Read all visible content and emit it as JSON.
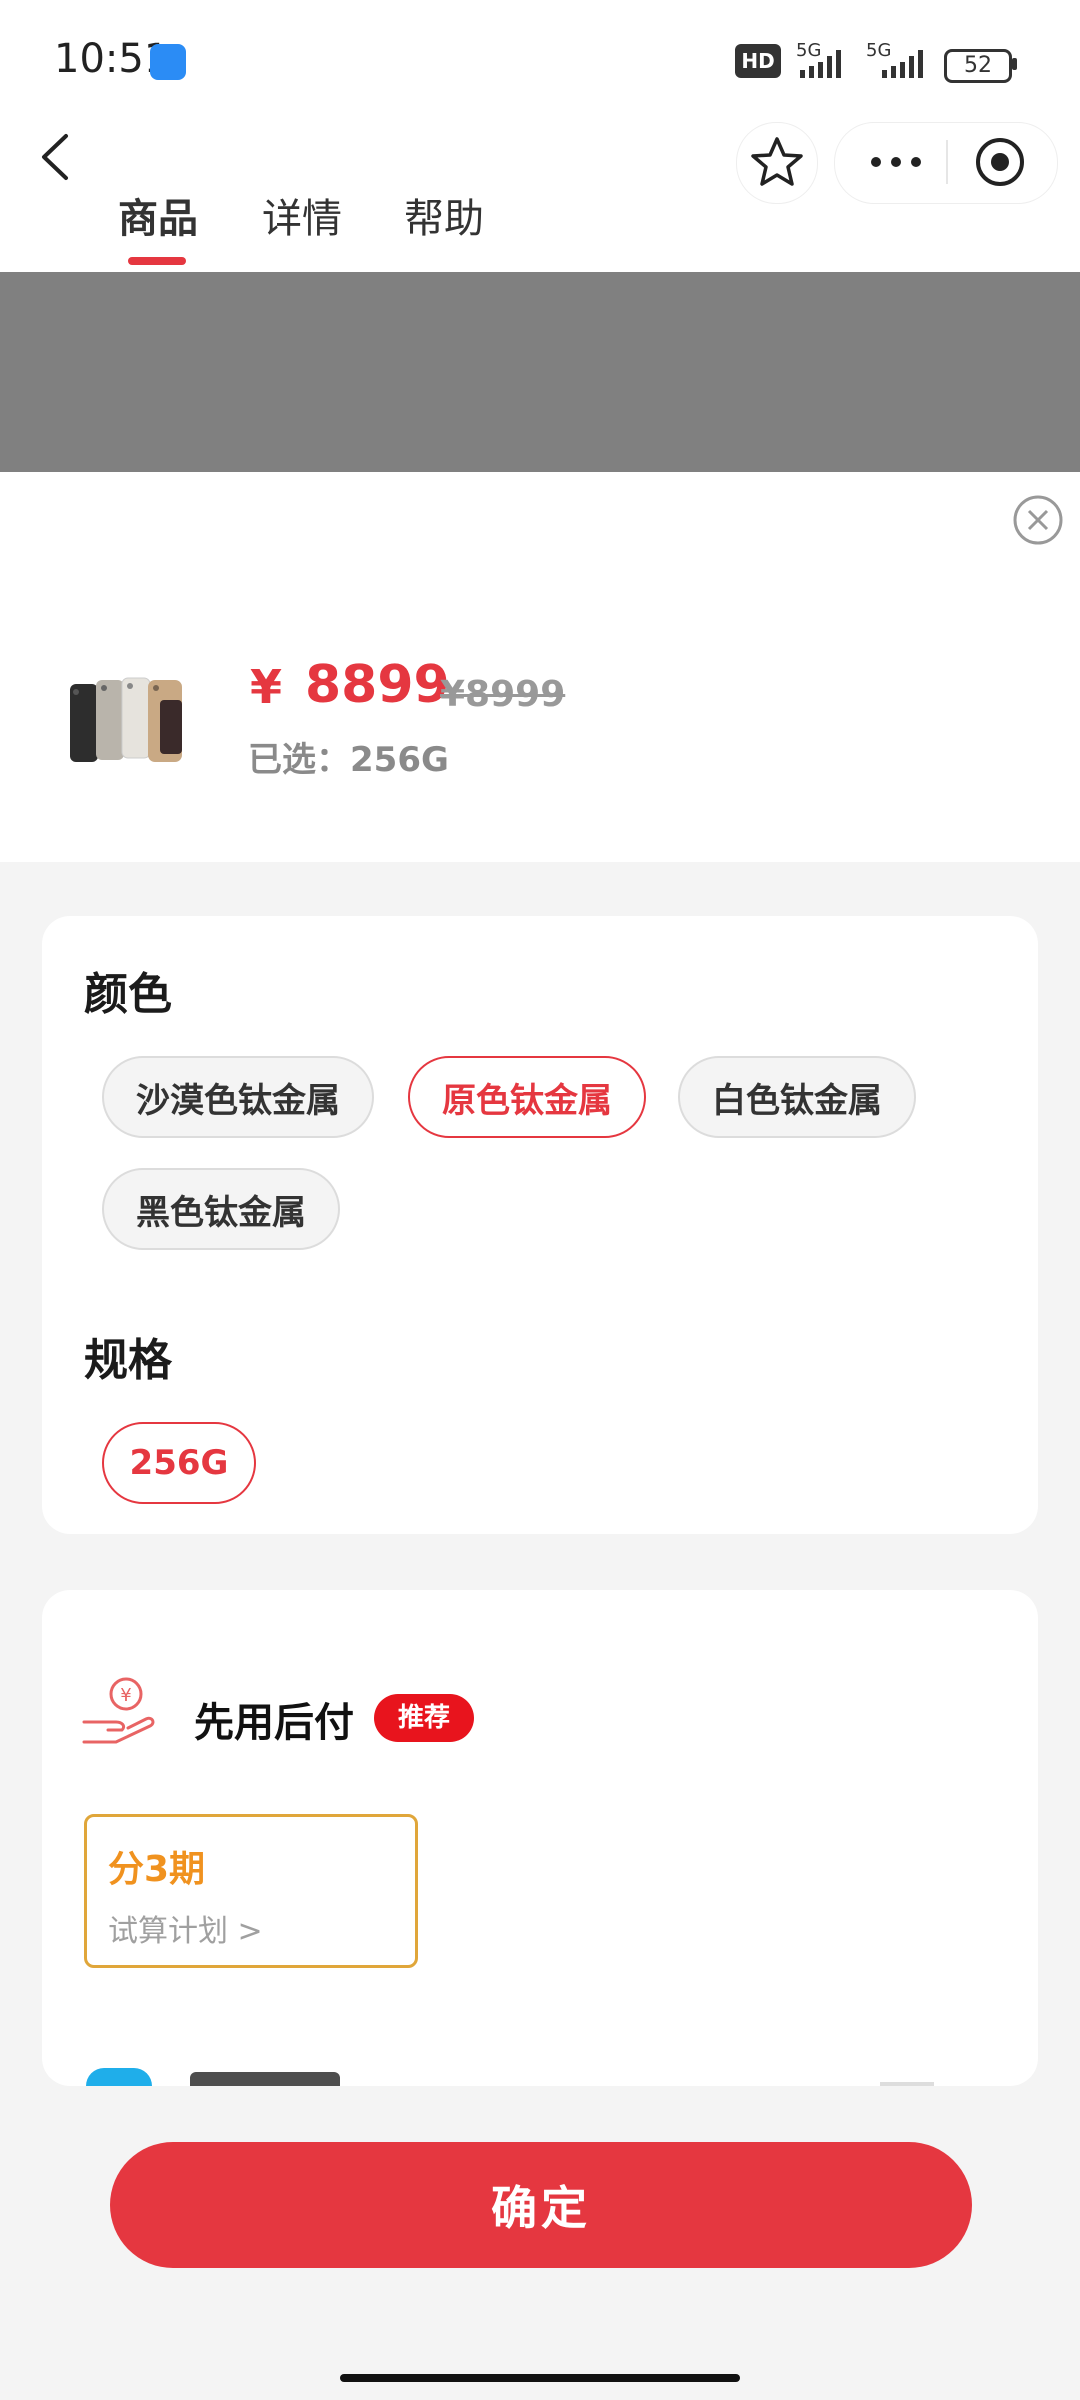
{
  "status_bar": {
    "time": "10:51",
    "hd_label": "HD",
    "net1": "5G",
    "net2": "5G",
    "battery": "52"
  },
  "nav": {
    "tabs": [
      {
        "label": "商品",
        "active": true
      },
      {
        "label": "详情",
        "active": false
      },
      {
        "label": "帮助",
        "active": false
      }
    ],
    "icons": [
      "back-icon",
      "star-icon",
      "more-icon",
      "target-icon"
    ]
  },
  "product": {
    "currency": "¥",
    "price": "8899",
    "original_price": "¥8999",
    "selected_label": "已选：256G"
  },
  "colors_section": {
    "title": "颜色",
    "options": [
      {
        "label": "沙漠色钛金属",
        "selected": false
      },
      {
        "label": "原色钛金属",
        "selected": true
      },
      {
        "label": "白色钛金属",
        "selected": false
      },
      {
        "label": "黑色钛金属",
        "selected": false
      }
    ]
  },
  "spec_section": {
    "title": "规格",
    "options": [
      {
        "label": "256G",
        "selected": true
      }
    ]
  },
  "payment": {
    "title": "先用后付",
    "badge": "推荐",
    "plan_title": "分3期",
    "plan_link": "试算计划 >"
  },
  "confirm_label": "确定",
  "accent_color": "#e53740",
  "plan_accent_color": "#f0921f"
}
